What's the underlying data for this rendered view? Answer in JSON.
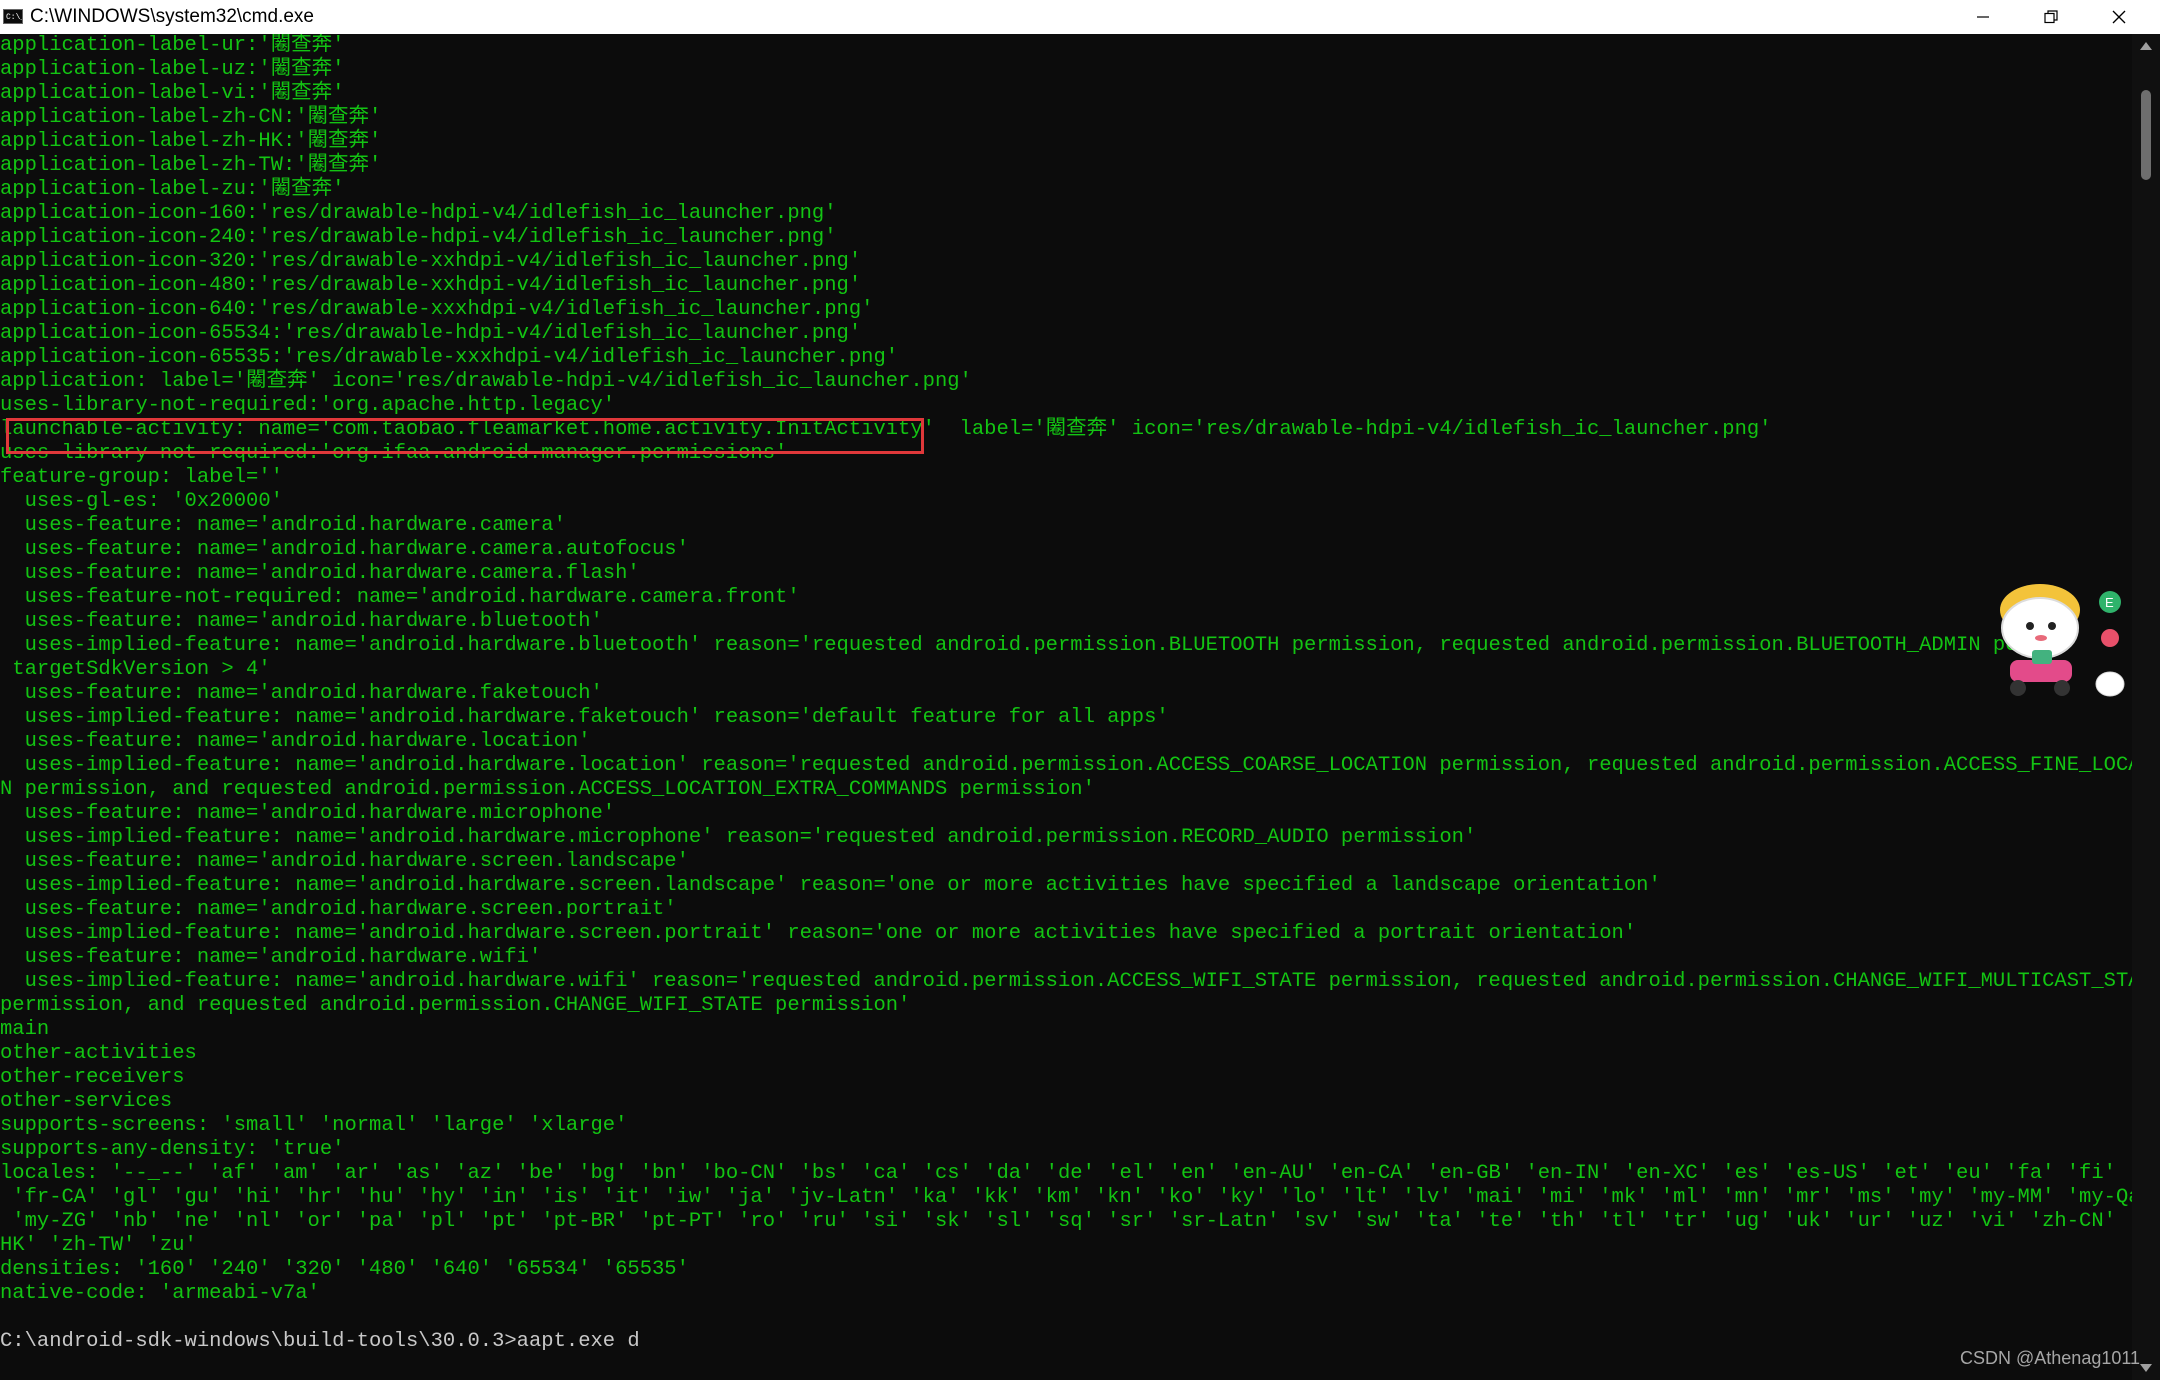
{
  "window": {
    "title": "C:\\WINDOWS\\system32\\cmd.exe",
    "app_icon_text": "C:\\_"
  },
  "console": {
    "lines": [
      "application-label-ur:'闂查奔'",
      "application-label-uz:'闂查奔'",
      "application-label-vi:'闂查奔'",
      "application-label-zh-CN:'闂查奔'",
      "application-label-zh-HK:'闂查奔'",
      "application-label-zh-TW:'闂查奔'",
      "application-label-zu:'闂查奔'",
      "application-icon-160:'res/drawable-hdpi-v4/idlefish_ic_launcher.png'",
      "application-icon-240:'res/drawable-hdpi-v4/idlefish_ic_launcher.png'",
      "application-icon-320:'res/drawable-xxhdpi-v4/idlefish_ic_launcher.png'",
      "application-icon-480:'res/drawable-xxhdpi-v4/idlefish_ic_launcher.png'",
      "application-icon-640:'res/drawable-xxxhdpi-v4/idlefish_ic_launcher.png'",
      "application-icon-65534:'res/drawable-hdpi-v4/idlefish_ic_launcher.png'",
      "application-icon-65535:'res/drawable-xxxhdpi-v4/idlefish_ic_launcher.png'",
      "application: label='闂查奔' icon='res/drawable-hdpi-v4/idlefish_ic_launcher.png'",
      "uses-library-not-required:'org.apache.http.legacy'",
      "launchable-activity: name='com.taobao.fleamarket.home.activity.InitActivity'  label='闂查奔' icon='res/drawable-hdpi-v4/idlefish_ic_launcher.png'",
      "uses-library-not-required:'org.ifaa.android.manager.permissions'",
      "feature-group: label=''",
      "  uses-gl-es: '0x20000'",
      "  uses-feature: name='android.hardware.camera'",
      "  uses-feature: name='android.hardware.camera.autofocus'",
      "  uses-feature: name='android.hardware.camera.flash'",
      "  uses-feature-not-required: name='android.hardware.camera.front'",
      "  uses-feature: name='android.hardware.bluetooth'",
      "  uses-implied-feature: name='android.hardware.bluetooth' reason='requested android.permission.BLUETOOTH permission, requested android.permission.BLUETOOTH_ADMIN permi",
      " targetSdkVersion > 4'",
      "  uses-feature: name='android.hardware.faketouch'",
      "  uses-implied-feature: name='android.hardware.faketouch' reason='default feature for all apps'",
      "  uses-feature: name='android.hardware.location'",
      "  uses-implied-feature: name='android.hardware.location' reason='requested android.permission.ACCESS_COARSE_LOCATION permission, requested android.permission.ACCESS_FINE_LOCATIO",
      "N permission, and requested android.permission.ACCESS_LOCATION_EXTRA_COMMANDS permission'",
      "  uses-feature: name='android.hardware.microphone'",
      "  uses-implied-feature: name='android.hardware.microphone' reason='requested android.permission.RECORD_AUDIO permission'",
      "  uses-feature: name='android.hardware.screen.landscape'",
      "  uses-implied-feature: name='android.hardware.screen.landscape' reason='one or more activities have specified a landscape orientation'",
      "  uses-feature: name='android.hardware.screen.portrait'",
      "  uses-implied-feature: name='android.hardware.screen.portrait' reason='one or more activities have specified a portrait orientation'",
      "  uses-feature: name='android.hardware.wifi'",
      "  uses-implied-feature: name='android.hardware.wifi' reason='requested android.permission.ACCESS_WIFI_STATE permission, requested android.permission.CHANGE_WIFI_MULTICAST_STATE",
      "permission, and requested android.permission.CHANGE_WIFI_STATE permission'",
      "main",
      "other-activities",
      "other-receivers",
      "other-services",
      "supports-screens: 'small' 'normal' 'large' 'xlarge'",
      "supports-any-density: 'true'",
      "locales: '--_--' 'af' 'am' 'ar' 'as' 'az' 'be' 'bg' 'bn' 'bo-CN' 'bs' 'ca' 'cs' 'da' 'de' 'el' 'en' 'en-AU' 'en-CA' 'en-GB' 'en-IN' 'en-XC' 'es' 'es-US' 'et' 'eu' 'fa' 'fi' 'fr'",
      " 'fr-CA' 'gl' 'gu' 'hi' 'hr' 'hu' 'hy' 'in' 'is' 'it' 'iw' 'ja' 'jv-Latn' 'ka' 'kk' 'km' 'kn' 'ko' 'ky' 'lo' 'lt' 'lv' 'mai' 'mi' 'mk' 'ml' 'mn' 'mr' 'ms' 'my' 'my-MM' 'my-Qaag'",
      " 'my-ZG' 'nb' 'ne' 'nl' 'or' 'pa' 'pl' 'pt' 'pt-BR' 'pt-PT' 'ro' 'ru' 'si' 'sk' 'sl' 'sq' 'sr' 'sr-Latn' 'sv' 'sw' 'ta' 'te' 'th' 'tl' 'tr' 'ug' 'uk' 'ur' 'uz' 'vi' 'zh-CN' 'zh-",
      "HK' 'zh-TW' 'zu'",
      "densities: '160' '240' '320' '480' '640' '65534' '65535'",
      "native-code: 'armeabi-v7a'",
      "",
      "C:\\android-sdk-windows\\build-tools\\30.0.3>aapt.exe d"
    ]
  },
  "watermark": "CSDN @Athenag1011",
  "colors": {
    "console_bg": "#0c0c0c",
    "console_text": "#13c413",
    "highlight_box": "#e0383a"
  },
  "icons": {
    "minimize": "minimize-icon",
    "maximize": "restore-icon",
    "close": "close-icon",
    "mascot": "cartoon-mascot-sticker"
  }
}
